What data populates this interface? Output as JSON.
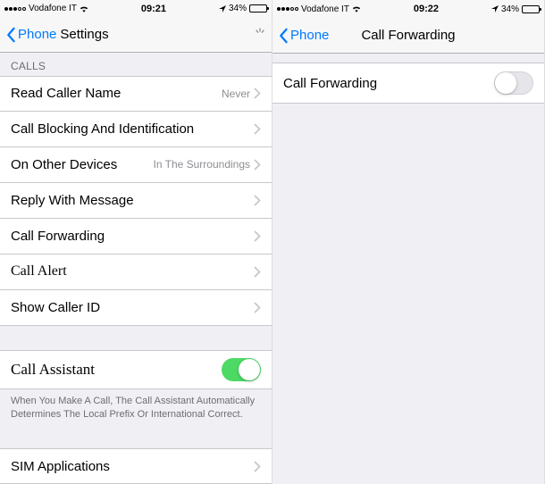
{
  "left": {
    "status": {
      "carrier": "Vodafone IT",
      "time": "09:21",
      "battery_pct": "34%"
    },
    "nav": {
      "back_label": "Phone",
      "title": "Settings"
    },
    "section_calls": "CALLS",
    "rows": {
      "read_caller": {
        "label": "Read Caller Name",
        "value": "Never"
      },
      "blocking": {
        "label": "Call Blocking And Identification"
      },
      "other_devices": {
        "label": "On Other Devices",
        "value": "In The Surroundings"
      },
      "reply_msg": {
        "label": "Reply With Message"
      },
      "call_forwarding": {
        "label": "Call Forwarding"
      },
      "call_alert": {
        "label": "Call Alert"
      },
      "show_caller_id": {
        "label": "Show Caller ID"
      },
      "call_assistant": {
        "label": "Call Assistant"
      },
      "sim_apps": {
        "label": "SIM Applications"
      }
    },
    "assistant_footer": "When You Make A Call, The Call Assistant Automatically Determines The Local Prefix Or International Correct."
  },
  "right": {
    "status": {
      "carrier": "Vodafone IT",
      "time": "09:22",
      "battery_pct": "34%"
    },
    "nav": {
      "back_label": "Phone",
      "title": "Call Forwarding"
    },
    "rows": {
      "call_forwarding": {
        "label": "Call Forwarding"
      }
    }
  }
}
